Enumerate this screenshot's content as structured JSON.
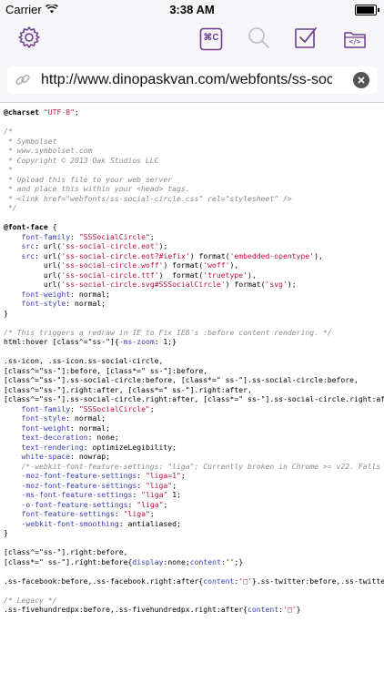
{
  "status": {
    "carrier": "Carrier",
    "time": "3:38 AM",
    "battery_level": 0.95
  },
  "toolbar": {
    "buttons": [
      {
        "name": "settings-button",
        "icon": "gear-icon"
      },
      {
        "name": "cmd-button",
        "icon": "command-key-icon"
      },
      {
        "name": "search-button",
        "icon": "magnifier-icon"
      },
      {
        "name": "checkbox-button",
        "icon": "checkmark-square-icon"
      },
      {
        "name": "source-folder-button",
        "icon": "code-folder-icon"
      }
    ],
    "cmd_label": "⌘C",
    "code_label": "</>"
  },
  "urlbar": {
    "url": "http://www.dinopaskvan.com/webfonts/ss-social…"
  },
  "accent_color": "#6d3d8c",
  "code_lines": [
    [
      {
        "t": "@charset ",
        "c": "at"
      },
      {
        "t": "\"UTF-8\"",
        "c": "st"
      },
      {
        "t": ";",
        "c": ""
      }
    ],
    [],
    [
      {
        "t": "/*",
        "c": "cm"
      }
    ],
    [
      {
        "t": " * Symbolset",
        "c": "cm"
      }
    ],
    [
      {
        "t": " * www.symbolset.com",
        "c": "cm"
      }
    ],
    [
      {
        "t": " * Copyright © 2013 Oak Studios LLC",
        "c": "cm"
      }
    ],
    [
      {
        "t": " *",
        "c": "cm"
      }
    ],
    [
      {
        "t": " * Upload this file to your web server",
        "c": "cm"
      }
    ],
    [
      {
        "t": " * and place this within your <head> tags.",
        "c": "cm"
      }
    ],
    [
      {
        "t": " * <link href=\"webfonts/ss-social-circle.css\" rel=\"stylesheet\" />",
        "c": "cm"
      }
    ],
    [
      {
        "t": " */",
        "c": "cm"
      }
    ],
    [],
    [
      {
        "t": "@font-face",
        "c": "at"
      },
      {
        "t": " {",
        "c": ""
      }
    ],
    [
      {
        "t": "    font-family",
        "c": "pr"
      },
      {
        "t": ": ",
        "c": ""
      },
      {
        "t": "\"SSSocialCircle\"",
        "c": "st"
      },
      {
        "t": ";",
        "c": ""
      }
    ],
    [
      {
        "t": "    src",
        "c": "pr"
      },
      {
        "t": ": url(",
        "c": ""
      },
      {
        "t": "'ss-social-circle.eot'",
        "c": "st"
      },
      {
        "t": ");",
        "c": ""
      }
    ],
    [
      {
        "t": "    src",
        "c": "pr"
      },
      {
        "t": ": url(",
        "c": ""
      },
      {
        "t": "'ss-social-circle.eot?#iefix'",
        "c": "st"
      },
      {
        "t": ") format(",
        "c": ""
      },
      {
        "t": "'embedded-opentype'",
        "c": "st"
      },
      {
        "t": "),",
        "c": ""
      }
    ],
    [
      {
        "t": "         url(",
        "c": ""
      },
      {
        "t": "'ss-social-circle.woff'",
        "c": "st"
      },
      {
        "t": ") format(",
        "c": ""
      },
      {
        "t": "'woff'",
        "c": "st"
      },
      {
        "t": "),",
        "c": ""
      }
    ],
    [
      {
        "t": "         url(",
        "c": ""
      },
      {
        "t": "'ss-social-circle.ttf'",
        "c": "st"
      },
      {
        "t": ")  format(",
        "c": ""
      },
      {
        "t": "'truetype'",
        "c": "st"
      },
      {
        "t": "),",
        "c": ""
      }
    ],
    [
      {
        "t": "         url(",
        "c": ""
      },
      {
        "t": "'ss-social-circle.svg#SSSocialCircle'",
        "c": "st"
      },
      {
        "t": ") format(",
        "c": ""
      },
      {
        "t": "'svg'",
        "c": "st"
      },
      {
        "t": ");",
        "c": ""
      }
    ],
    [
      {
        "t": "    font-weight",
        "c": "pr"
      },
      {
        "t": ": normal;",
        "c": ""
      }
    ],
    [
      {
        "t": "    font-style",
        "c": "pr"
      },
      {
        "t": ": normal;",
        "c": ""
      }
    ],
    [
      {
        "t": "}",
        "c": ""
      }
    ],
    [],
    [
      {
        "t": "/* This triggers a redraw in IE to Fix IE8's :before content rendering. */",
        "c": "cm"
      }
    ],
    [
      {
        "t": "html:hover [class^=\"ss-\"]{",
        "c": ""
      },
      {
        "t": "-ms-zoom",
        "c": "pr"
      },
      {
        "t": ": 1;}",
        "c": ""
      }
    ],
    [],
    [
      {
        "t": ".ss-icon, .ss-icon.ss-social-circle,",
        "c": ""
      }
    ],
    [
      {
        "t": "[class^=\"ss-\"]:before, [class*=\" ss-\"]:before,",
        "c": ""
      }
    ],
    [
      {
        "t": "[class^=\"ss-\"].ss-social-circle:before, [class*=\" ss-\"].ss-social-circle:before,",
        "c": ""
      }
    ],
    [
      {
        "t": "[class^=\"ss-\"].right:after, [class*=\" ss-\"].right:after,",
        "c": ""
      }
    ],
    [
      {
        "t": "[class^=\"ss-\"].ss-social-circle.right:after, [class*=\" ss-\"].ss-social-circle.right:after {",
        "c": ""
      }
    ],
    [
      {
        "t": "    font-family",
        "c": "pr"
      },
      {
        "t": ": ",
        "c": ""
      },
      {
        "t": "\"SSSocialCircle\"",
        "c": "st"
      },
      {
        "t": ";",
        "c": ""
      }
    ],
    [
      {
        "t": "    font-style",
        "c": "pr"
      },
      {
        "t": ": normal;",
        "c": ""
      }
    ],
    [
      {
        "t": "    font-weight",
        "c": "pr"
      },
      {
        "t": ": normal;",
        "c": ""
      }
    ],
    [
      {
        "t": "    text-decoration",
        "c": "pr"
      },
      {
        "t": ": none;",
        "c": ""
      }
    ],
    [
      {
        "t": "    text-rendering",
        "c": "pr"
      },
      {
        "t": ": optimizeLegibility;",
        "c": ""
      }
    ],
    [
      {
        "t": "    white-space",
        "c": "pr"
      },
      {
        "t": ": nowrap;",
        "c": ""
      }
    ],
    [
      {
        "t": "    /*-webkit-font-feature-settings: \"liga\"; Currently broken in Chrome >= v22. Falls back",
        "c": "cm"
      }
    ],
    [
      {
        "t": "    -moz-font-feature-settings",
        "c": "pr"
      },
      {
        "t": ": ",
        "c": ""
      },
      {
        "t": "\"liga=1\"",
        "c": "st"
      },
      {
        "t": ";",
        "c": ""
      }
    ],
    [
      {
        "t": "    -moz-font-feature-settings",
        "c": "pr"
      },
      {
        "t": ": ",
        "c": ""
      },
      {
        "t": "\"liga\"",
        "c": "st"
      },
      {
        "t": ";",
        "c": ""
      }
    ],
    [
      {
        "t": "    -ms-font-feature-settings",
        "c": "pr"
      },
      {
        "t": ": ",
        "c": ""
      },
      {
        "t": "\"liga\"",
        "c": "st"
      },
      {
        "t": " 1;",
        "c": ""
      }
    ],
    [
      {
        "t": "    -o-font-feature-settings",
        "c": "pr"
      },
      {
        "t": ": ",
        "c": ""
      },
      {
        "t": "\"liga\"",
        "c": "st"
      },
      {
        "t": ";",
        "c": ""
      }
    ],
    [
      {
        "t": "    font-feature-settings",
        "c": "pr"
      },
      {
        "t": ": ",
        "c": ""
      },
      {
        "t": "\"liga\"",
        "c": "st"
      },
      {
        "t": ";",
        "c": ""
      }
    ],
    [
      {
        "t": "    -webkit-font-smoothing",
        "c": "pr"
      },
      {
        "t": ": antialiased;",
        "c": ""
      }
    ],
    [
      {
        "t": "}",
        "c": ""
      }
    ],
    [],
    [
      {
        "t": "[class^=\"ss-\"].right:before,",
        "c": ""
      }
    ],
    [
      {
        "t": "[class*=\" ss-\"].right:before{",
        "c": ""
      },
      {
        "t": "display",
        "c": "pr"
      },
      {
        "t": ":none;",
        "c": ""
      },
      {
        "t": "content",
        "c": "pr"
      },
      {
        "t": ":'';}",
        "c": ""
      }
    ],
    [],
    [
      {
        "t": ".ss-facebook:before,.ss-facebook.right:after{",
        "c": ""
      },
      {
        "t": "content",
        "c": "pr"
      },
      {
        "t": ":",
        "c": ""
      },
      {
        "t": "'□'",
        "c": "st"
      },
      {
        "t": "}.ss-twitter:before,.ss-twitter",
        "c": ""
      }
    ],
    [],
    [
      {
        "t": "/* Legacy */",
        "c": "cm"
      }
    ],
    [
      {
        "t": ".ss-fivehundredpx:before,.ss-fivehundredpx.right:after{",
        "c": ""
      },
      {
        "t": "content",
        "c": "pr"
      },
      {
        "t": ":",
        "c": ""
      },
      {
        "t": "'□'",
        "c": "st"
      },
      {
        "t": "}",
        "c": ""
      }
    ]
  ]
}
